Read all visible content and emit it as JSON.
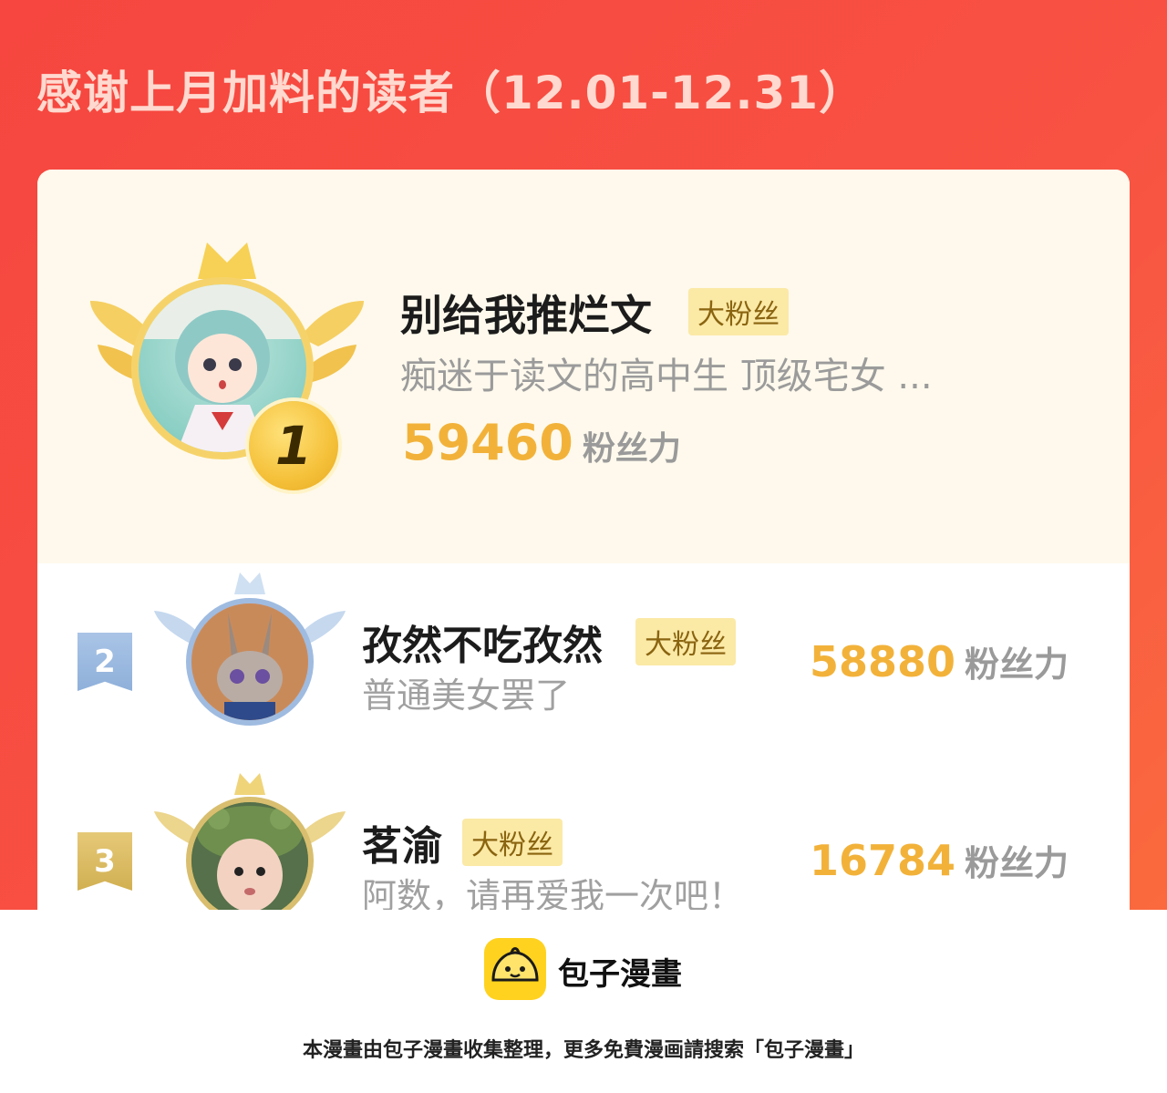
{
  "banner": {
    "title": "感谢上月加料的读者（12.01-12.31）"
  },
  "leaderboard": {
    "unit_label": "粉丝力",
    "entries": [
      {
        "rank": "1",
        "name": "别给我推烂文",
        "badge": "大粉丝",
        "signature": "痴迷于读文的高中生 顶级宅女 ...",
        "score": "59460",
        "medal_color": "#f5c13a"
      },
      {
        "rank": "2",
        "name": "孜然不吃孜然",
        "badge": "大粉丝",
        "signature": "普通美女罢了",
        "score": "58880",
        "medal_color": "#8fb0da"
      },
      {
        "rank": "3",
        "name": "茗渝",
        "badge": "大粉丝",
        "signature": "阿数，请再爱我一次吧！",
        "score": "16784",
        "medal_color": "#d1b052"
      }
    ]
  },
  "footer": {
    "brand": "包子漫畫",
    "note": "本漫畫由包子漫畫收集整理，更多免費漫画請搜索「包子漫畫」"
  },
  "colors": {
    "banner": "#f6463f",
    "score": "#f2b23a",
    "badge_bg": "#fbe9a6"
  }
}
